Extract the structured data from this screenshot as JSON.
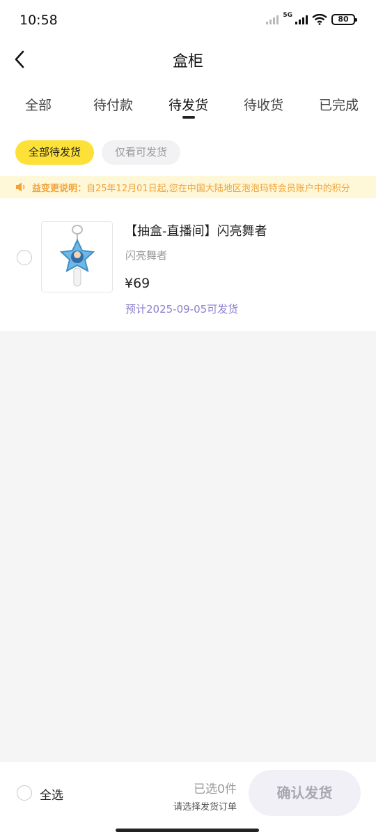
{
  "status_bar": {
    "time": "10:58",
    "network": "5G",
    "battery": "80"
  },
  "nav": {
    "title": "盒柜",
    "back_icon": "chevron-left-icon"
  },
  "tabs": [
    {
      "label": "全部"
    },
    {
      "label": "待付款"
    },
    {
      "label": "待发货",
      "active": true
    },
    {
      "label": "待收货"
    },
    {
      "label": "已完成"
    }
  ],
  "filters": {
    "all_pending": "全部待发货",
    "shippable_only": "仅看可发货"
  },
  "notice": {
    "icon": "speaker-icon",
    "title": "益变更说明：",
    "text": "自25年12月01日起,您在中国大陆地区泡泡玛特会员账户中的积分"
  },
  "items": [
    {
      "name": "【抽盒-直播间】闪亮舞者",
      "variant": "闪亮舞者",
      "price": "¥69",
      "eta": "预计2025-09-05可发货"
    }
  ],
  "footer": {
    "select_all": "全选",
    "selected_count": "已选0件",
    "hint": "请选择发货订单",
    "confirm": "确认发货"
  },
  "colors": {
    "accent": "#fde138",
    "notice_bg": "#fff8d8",
    "notice_text": "#f0a23b",
    "eta": "#8a7fcf"
  }
}
